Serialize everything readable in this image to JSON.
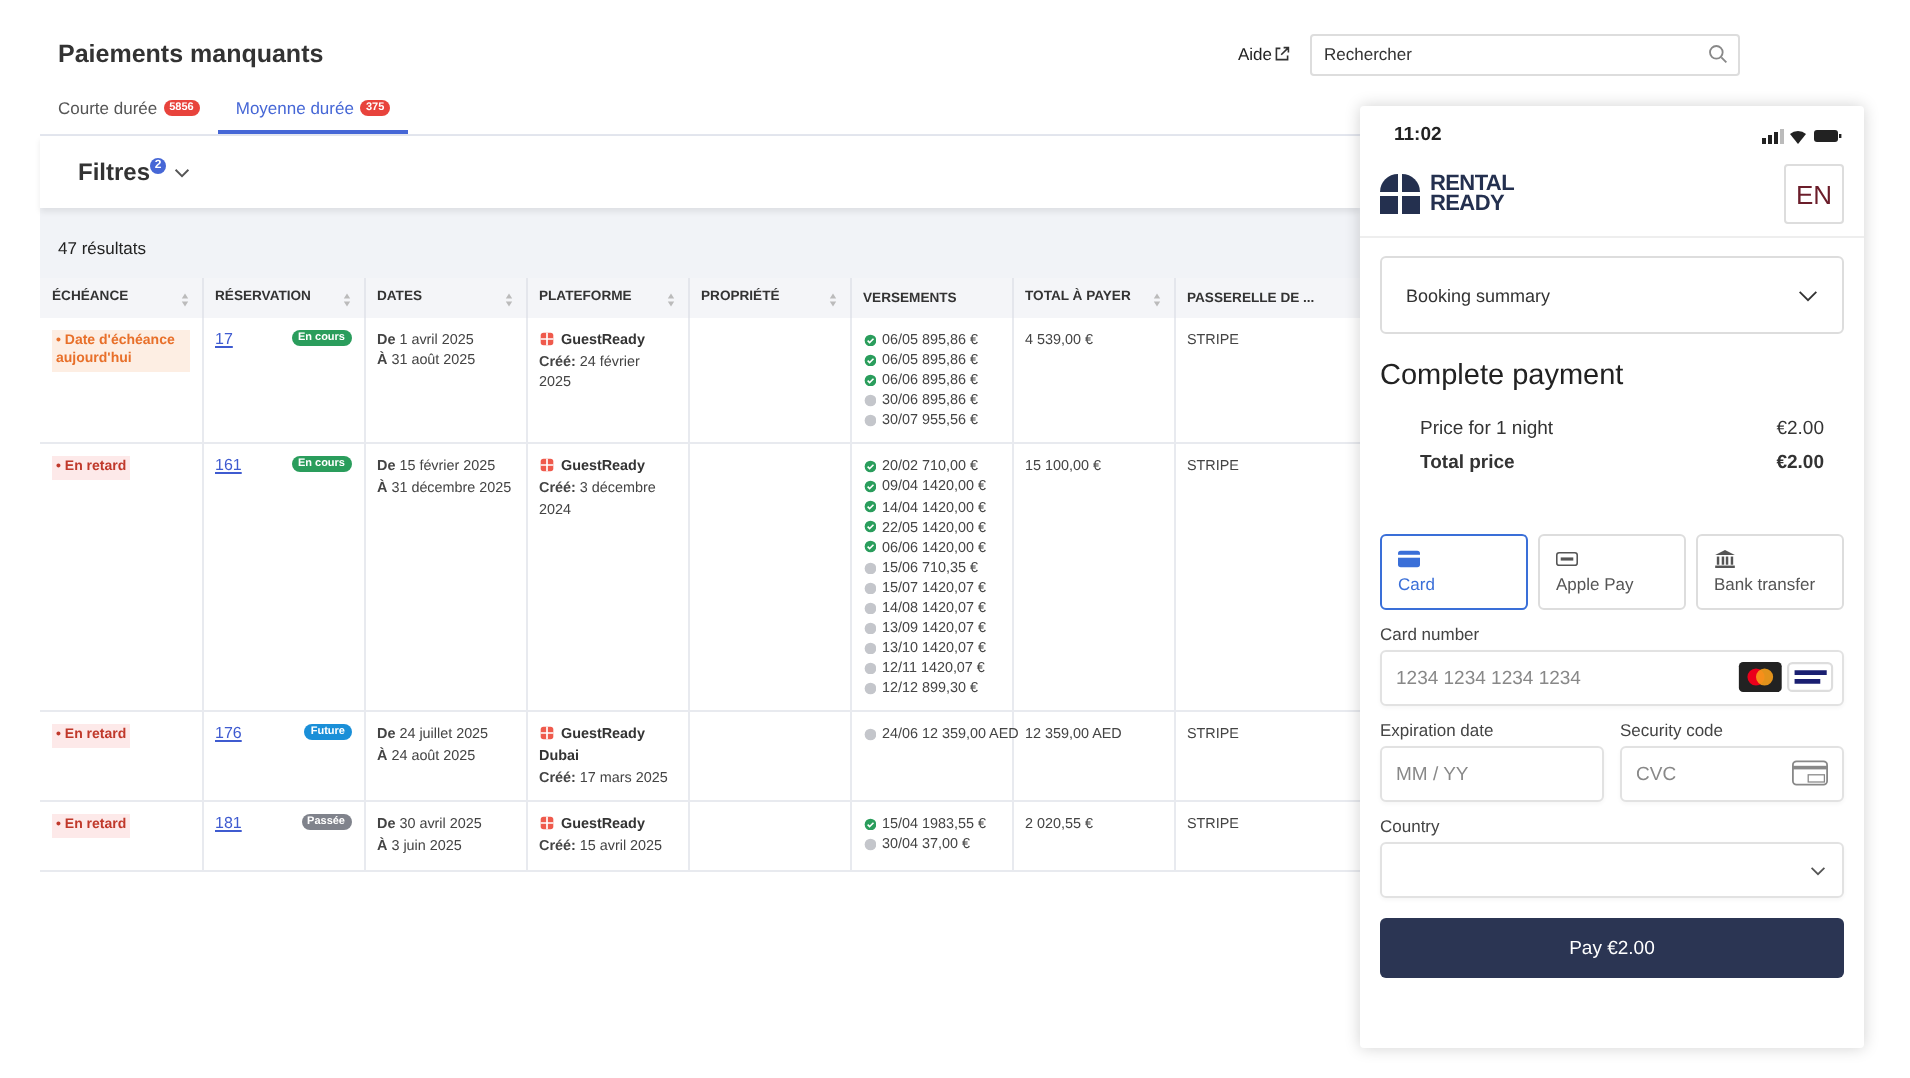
{
  "header": {
    "title": "Paiements manquants",
    "help": "Aide",
    "search": {
      "placeholder": "Rechercher"
    }
  },
  "tabs": [
    {
      "label": "Courte durée",
      "count": "5856",
      "selected": false
    },
    {
      "label": "Moyenne durée",
      "count": "375",
      "selected": true
    }
  ],
  "filters": {
    "label": "Filtres",
    "count": "2"
  },
  "results": "47 résultats",
  "table": {
    "columns": [
      "ÉCHÉANCE",
      "RÉSERVATION",
      "DATES",
      "PLATEFORME",
      "PROPRIÉTÉ",
      "VERSEMENTS",
      "TOTAL À PAYER",
      "PASSERELLE DE ..."
    ],
    "rows": [
      {
        "due": {
          "kind": "today",
          "text": "• Date d'échéance aujourd'hui"
        },
        "reservation": "17",
        "status": {
          "text": "En cours",
          "color": "#2a9d5c"
        },
        "dates": [
          "**De** 1 avril 2025",
          "**À** 31 août 2025"
        ],
        "platform": {
          "name": "GuestReady",
          "created": "**Créé:** 24 février 2025"
        },
        "payments": [
          {
            "date": "06/05",
            "amount": "895,86 €",
            "paid": true
          },
          {
            "date": "06/05",
            "amount": "895,86 €",
            "paid": true
          },
          {
            "date": "06/06",
            "amount": "895,86 €",
            "paid": true
          },
          {
            "date": "30/06",
            "amount": "895,86 €",
            "paid": false
          },
          {
            "date": "30/07",
            "amount": "955,56 €",
            "paid": false
          }
        ],
        "total": "4 539,00 €",
        "gateway": "STRIPE"
      },
      {
        "due": {
          "kind": "late",
          "text": "• En retard"
        },
        "reservation": "161",
        "status": {
          "text": "En cours",
          "color": "#2a9d5c"
        },
        "dates": [
          "**De** 15 février 2025",
          "**À** 31 décembre 2025"
        ],
        "platform": {
          "name": "GuestReady",
          "created": "**Créé:** 3 décembre 2024"
        },
        "payments": [
          {
            "date": "20/02",
            "amount": "710,00 €",
            "paid": true
          },
          {
            "date": "09/04",
            "amount": "1420,00 €",
            "paid": true
          },
          {
            "date": "14/04",
            "amount": "1420,00 €",
            "paid": true
          },
          {
            "date": "22/05",
            "amount": "1420,00 €",
            "paid": true
          },
          {
            "date": "06/06",
            "amount": "1420,00 €",
            "paid": true
          },
          {
            "date": "15/06",
            "amount": "710,35 €",
            "paid": false
          },
          {
            "date": "15/07",
            "amount": "1420,07 €",
            "paid": false
          },
          {
            "date": "14/08",
            "amount": "1420,07 €",
            "paid": false
          },
          {
            "date": "13/09",
            "amount": "1420,07 €",
            "paid": false
          },
          {
            "date": "13/10",
            "amount": "1420,07 €",
            "paid": false
          },
          {
            "date": "12/11",
            "amount": "1420,07 €",
            "paid": false
          },
          {
            "date": "12/12",
            "amount": "899,30 €",
            "paid": false
          }
        ],
        "total": "15 100,00 €",
        "gateway": "STRIPE"
      },
      {
        "due": {
          "kind": "late",
          "text": "• En retard"
        },
        "reservation": "176",
        "status": {
          "text": "Future",
          "color": "#1a8fd8"
        },
        "dates": [
          "**De** 24 juillet 2025",
          "**À** 24 août 2025"
        ],
        "platform": {
          "name": "GuestReady",
          "location": "Dubai",
          "created": "**Créé:** 17 mars 2025"
        },
        "payments": [
          {
            "date": "24/06",
            "amount": "12 359,00 AED",
            "paid": false
          }
        ],
        "total": "12 359,00 AED",
        "gateway": "STRIPE"
      },
      {
        "due": {
          "kind": "late",
          "text": "• En retard"
        },
        "reservation": "181",
        "status": {
          "text": "Passée",
          "color": "#80838c"
        },
        "dates": [
          "**De** 30 avril 2025",
          "**À** 3 juin 2025"
        ],
        "platform": {
          "name": "GuestReady",
          "created": "**Créé:** 15 avril 2025"
        },
        "payments": [
          {
            "date": "15/04",
            "amount": "1983,55 €",
            "paid": true
          },
          {
            "date": "30/04",
            "amount": "37,00 €",
            "paid": false
          }
        ],
        "total": "2 020,55 €",
        "gateway": "STRIPE"
      }
    ]
  },
  "phone": {
    "time": "11:02",
    "brand": [
      "RENTAL",
      "READY"
    ],
    "language": "EN",
    "summary": "Booking summary",
    "heading": "Complete payment",
    "prices": [
      {
        "label": "Price for 1 night",
        "value": "€2.00",
        "total": false
      },
      {
        "label": "Total price",
        "value": "€2.00",
        "total": true
      }
    ],
    "methods": [
      {
        "kind": "card",
        "label": "Card",
        "selected": true
      },
      {
        "kind": "applepay",
        "label": "Apple Pay",
        "selected": false
      },
      {
        "kind": "bank",
        "label": "Bank transfer",
        "selected": false
      }
    ],
    "card_number": {
      "label": "Card number",
      "placeholder": "1234 1234 1234 1234"
    },
    "expiry": {
      "label": "Expiration date",
      "placeholder": "MM / YY"
    },
    "cvc": {
      "label": "Security code",
      "placeholder": "CVC"
    },
    "country": {
      "label": "Country"
    },
    "pay": "Pay €2.00"
  }
}
